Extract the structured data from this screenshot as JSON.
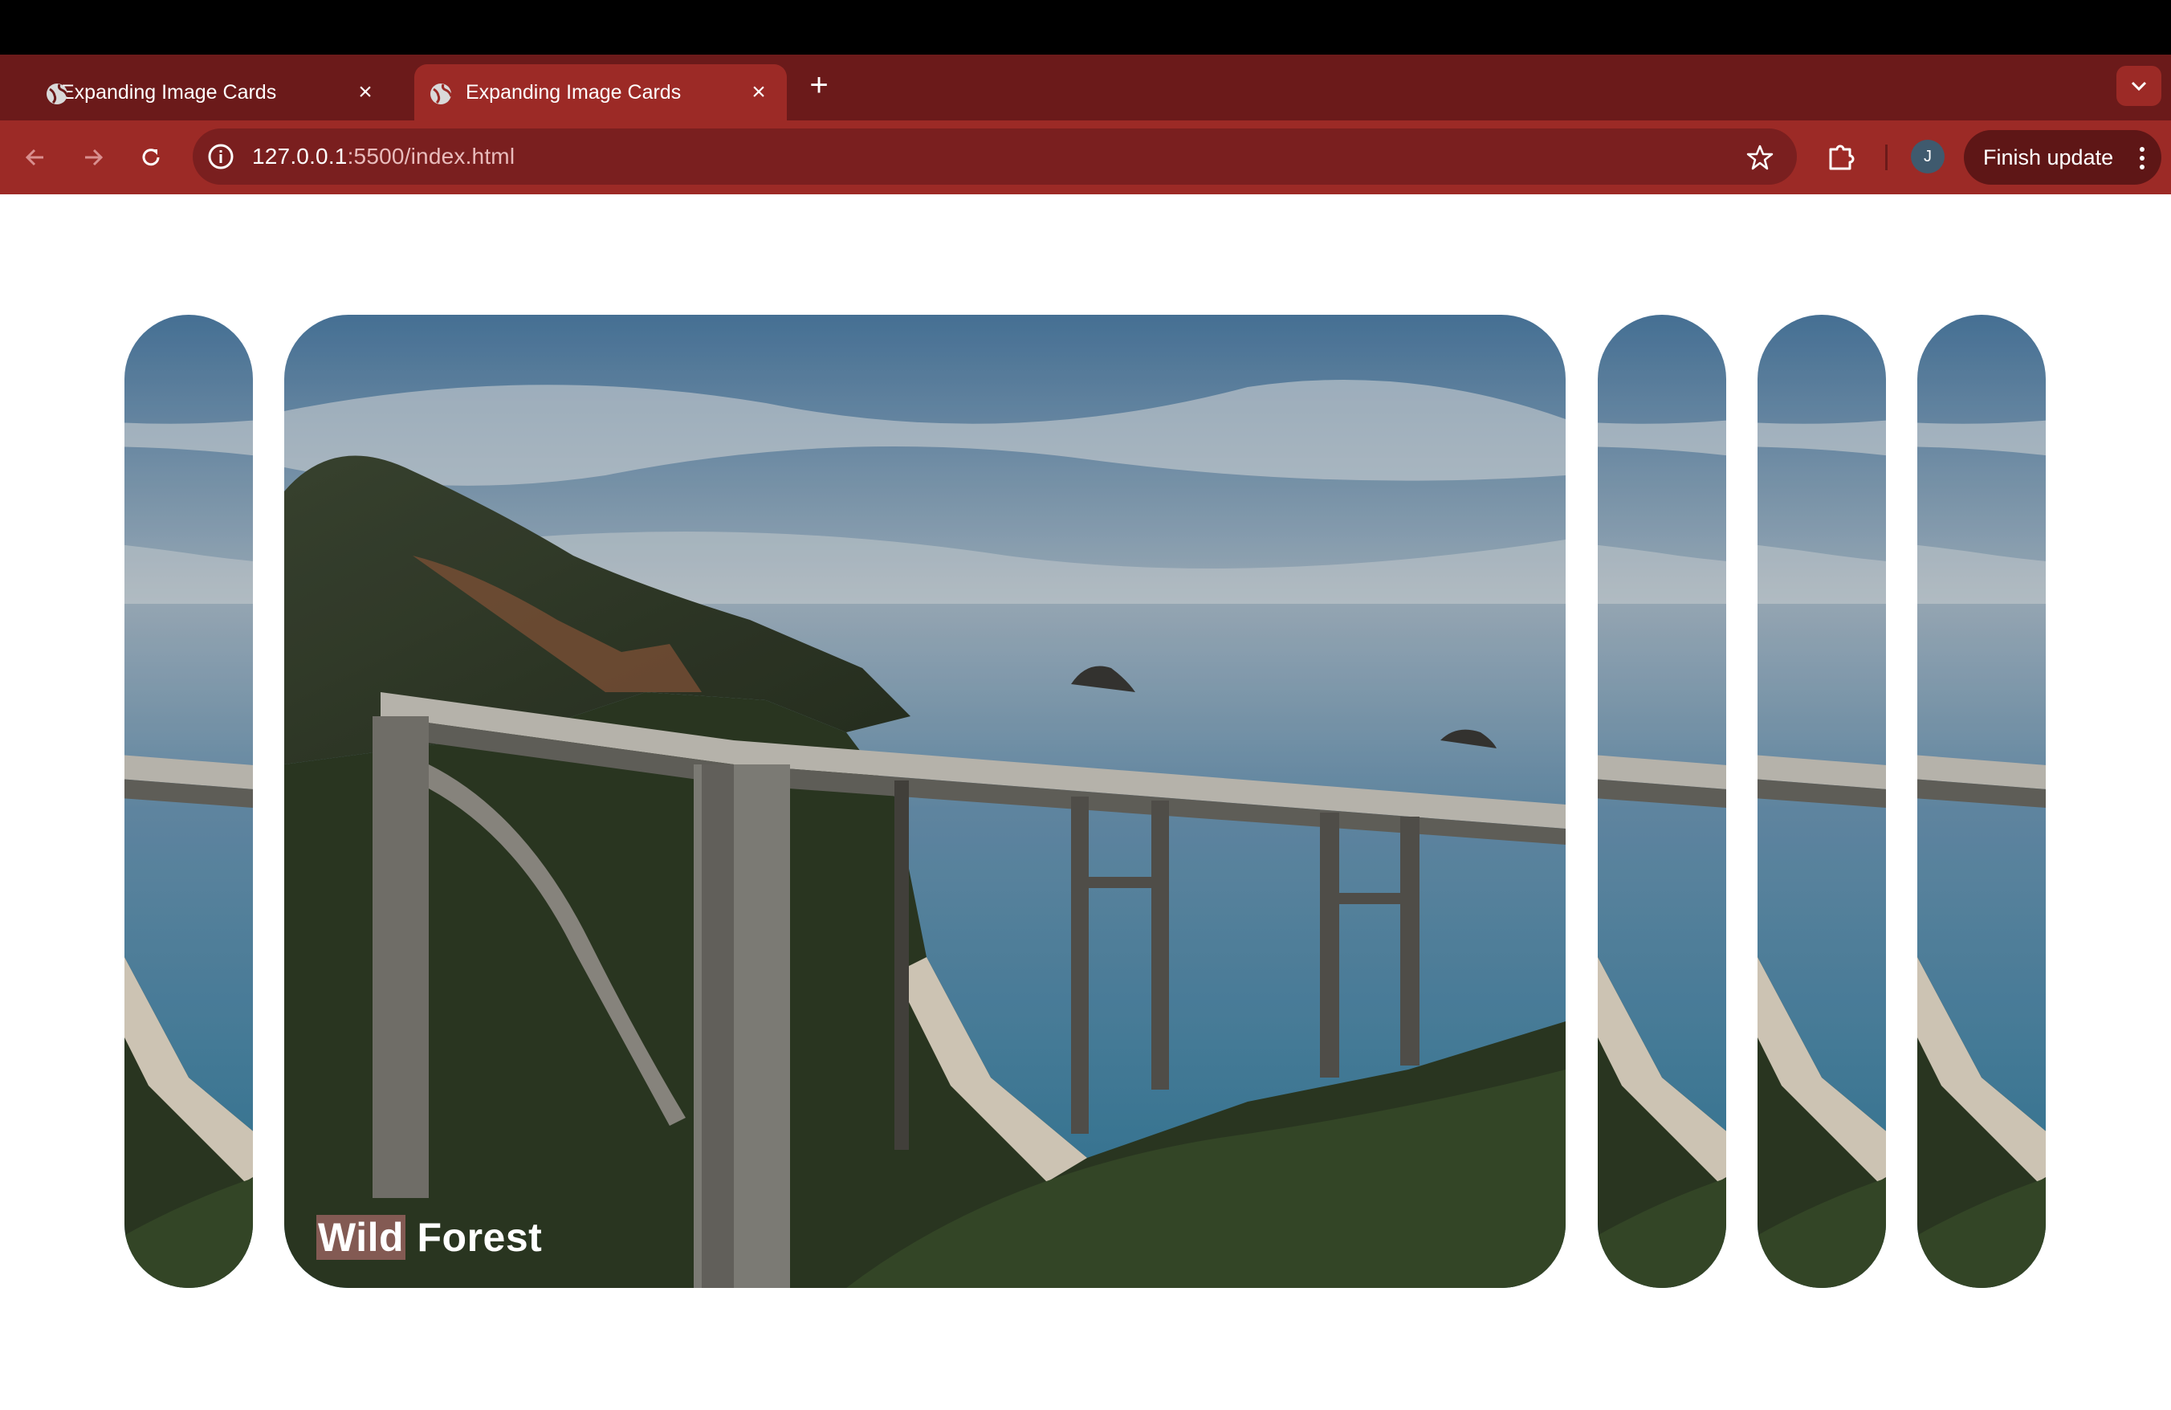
{
  "browser": {
    "tabs": [
      {
        "title": "Expanding Image Cards",
        "active": false
      },
      {
        "title": "Expanding Image Cards",
        "active": true
      }
    ],
    "url_host": "127.0.0.1",
    "url_path": ":5500/index.html",
    "avatar_initial": "J",
    "update_label": "Finish update",
    "theme_color": "#9c2a26"
  },
  "cards": {
    "active_title_word1": "Wild",
    "active_title_word2": "Forest",
    "count": 5
  }
}
